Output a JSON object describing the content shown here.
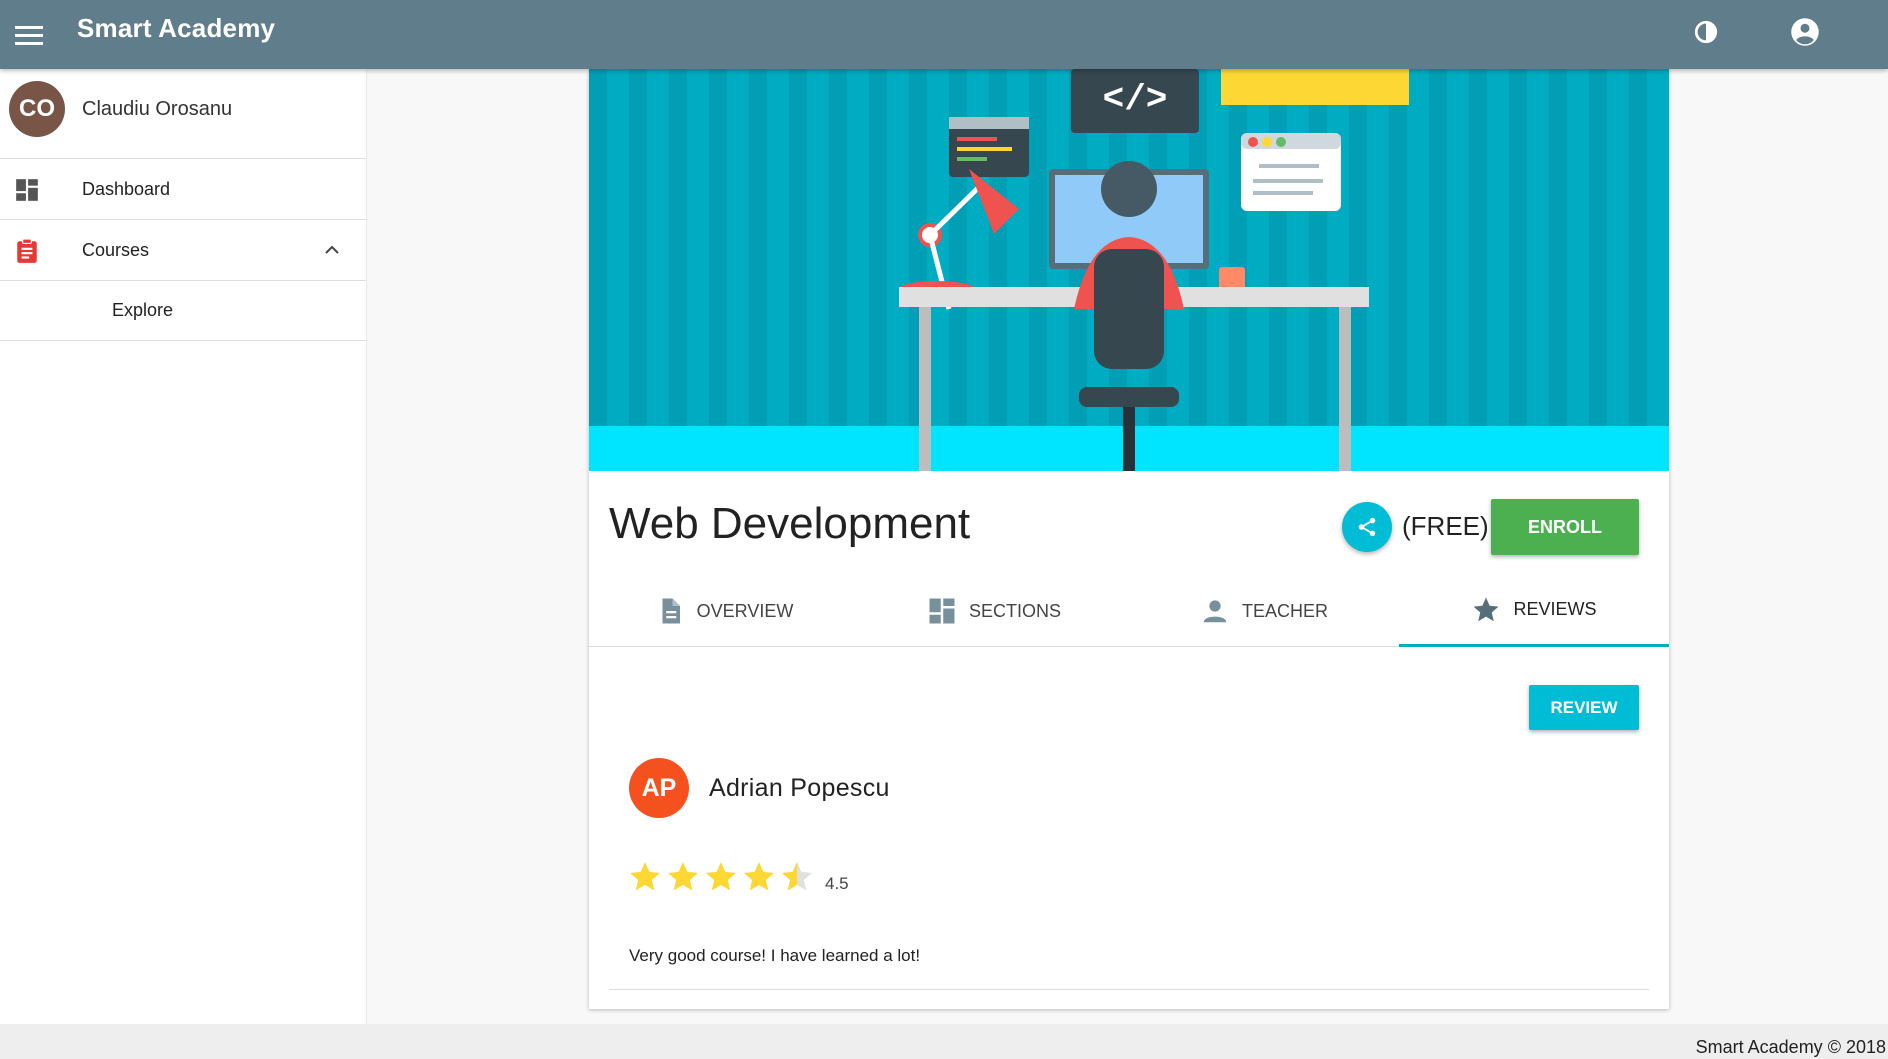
{
  "app": {
    "title": "Smart Academy",
    "theme_color": "#607d8b",
    "icons": [
      "menu-icon",
      "contrast-icon",
      "account-circle-icon"
    ]
  },
  "sidebar": {
    "user": {
      "initials": "CO",
      "name": "Claudiu Orosanu",
      "avatar_color": "#795548"
    },
    "items": [
      {
        "label": "Dashboard",
        "icon": "dashboard-icon"
      },
      {
        "label": "Courses",
        "icon": "assignment-icon",
        "expanded": true,
        "children": [
          {
            "label": "Explore"
          }
        ]
      }
    ]
  },
  "course": {
    "title": "Web Development",
    "price": "(FREE)",
    "enroll_label": "ENROLL",
    "share_icon": "share-icon",
    "tabs": [
      {
        "label": "OVERVIEW",
        "icon": "document-icon"
      },
      {
        "label": "SECTIONS",
        "icon": "sections-icon"
      },
      {
        "label": "TEACHER",
        "icon": "person-icon"
      },
      {
        "label": "REVIEWS",
        "icon": "star-icon",
        "active": true
      }
    ],
    "review_button": "REVIEW",
    "reviews": [
      {
        "initials": "AP",
        "author": "Adrian Popescu",
        "avatar_color": "#f4511e",
        "rating": 4.5,
        "rating_text": "4.5",
        "comment": "Very good course! I have learned a lot!"
      }
    ]
  },
  "footer": {
    "text": "Smart Academy © 2018"
  }
}
